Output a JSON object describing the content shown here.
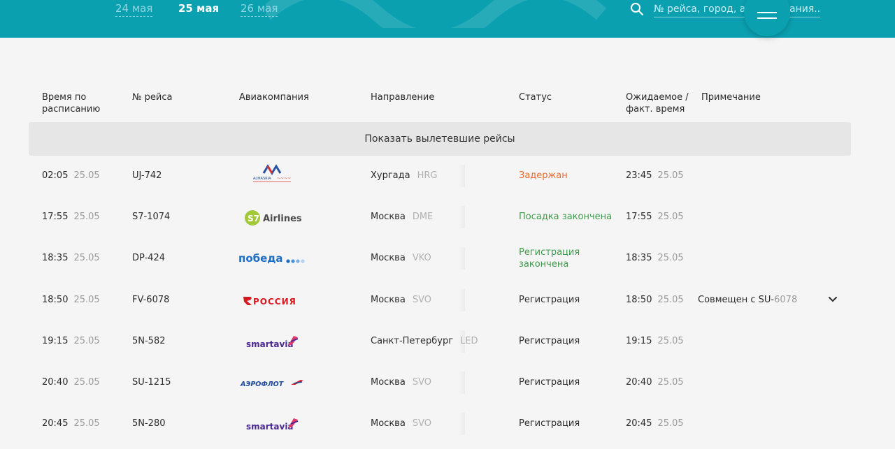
{
  "header": {
    "dates": [
      {
        "label": "24 мая",
        "active": false
      },
      {
        "label": "25 мая",
        "active": true
      },
      {
        "label": "26 мая",
        "active": false
      }
    ],
    "search_placeholder": "№ рейса, город, авиакомпания...",
    "menu_icon": "hamburger-icon",
    "search_icon": "search-icon",
    "accent_color": "#0aa0b0"
  },
  "columns": {
    "scheduled": "Время по расписанию",
    "flight": "№ рейса",
    "airline": "Авиакомпания",
    "direction": "Направление",
    "status": "Статус",
    "expected": "Ожидаемое / факт. время",
    "note": "Примечание"
  },
  "show_departed_label": "Показать вылетевшие рейсы",
  "flights": [
    {
      "time": "02:05",
      "date": "25.05",
      "flight": "UJ-742",
      "airline": "AlMasria Universal Airlines",
      "logo": "ALMASRIA",
      "city": "Хургада",
      "code": "HRG",
      "status": "Задержан",
      "status_type": "delayed",
      "exp_time": "23:45",
      "exp_date": "25.05",
      "note": "",
      "note_code": ""
    },
    {
      "time": "17:55",
      "date": "25.05",
      "flight": "S7-1074",
      "airline": "S7 Airlines",
      "logo": "Airlines",
      "city": "Москва",
      "code": "DME",
      "status": "Посадка закончена",
      "status_type": "done",
      "exp_time": "17:55",
      "exp_date": "25.05",
      "note": "",
      "note_code": ""
    },
    {
      "time": "18:35",
      "date": "25.05",
      "flight": "DP-424",
      "airline": "Победа",
      "logo": "победа",
      "city": "Москва",
      "code": "VKO",
      "status": "Регистрация закончена",
      "status_type": "done",
      "exp_time": "18:35",
      "exp_date": "25.05",
      "note": "",
      "note_code": ""
    },
    {
      "time": "18:50",
      "date": "25.05",
      "flight": "FV-6078",
      "airline": "Россия",
      "logo": "РОССИЯ",
      "city": "Москва",
      "code": "SVO",
      "status": "Регистрация",
      "status_type": "normal",
      "exp_time": "18:50",
      "exp_date": "25.05",
      "note": "Совмещен с SU-",
      "note_code": "6078"
    },
    {
      "time": "19:15",
      "date": "25.05",
      "flight": "5N-582",
      "airline": "Smartavia",
      "logo": "smartavia",
      "city": "Санкт-Петербург",
      "code": "LED",
      "status": "Регистрация",
      "status_type": "normal",
      "exp_time": "19:15",
      "exp_date": "25.05",
      "note": "",
      "note_code": ""
    },
    {
      "time": "20:40",
      "date": "25.05",
      "flight": "SU-1215",
      "airline": "Аэрофлот",
      "logo": "АЭРОФЛОТ",
      "city": "Москва",
      "code": "SVO",
      "status": "Регистрация",
      "status_type": "normal",
      "exp_time": "20:40",
      "exp_date": "25.05",
      "note": "",
      "note_code": ""
    },
    {
      "time": "20:45",
      "date": "25.05",
      "flight": "5N-280",
      "airline": "Smartavia",
      "logo": "smartavia",
      "city": "Москва",
      "code": "SVO",
      "status": "Регистрация",
      "status_type": "normal",
      "exp_time": "20:45",
      "exp_date": "25.05",
      "note": "",
      "note_code": ""
    }
  ]
}
